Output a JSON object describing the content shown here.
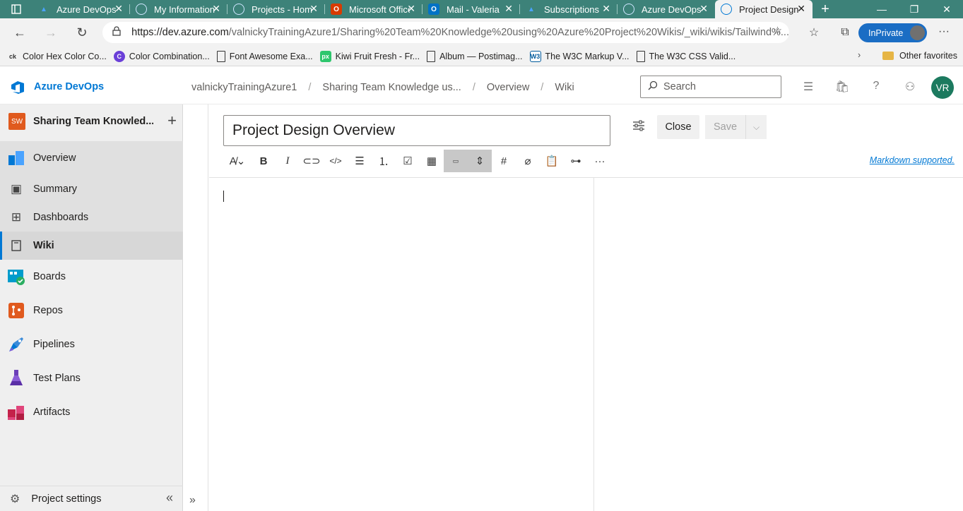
{
  "browser": {
    "tabs": [
      {
        "title": "Azure DevOps",
        "icon": "azure-devops-icon",
        "color": "#0078d4"
      },
      {
        "title": "My Information",
        "icon": "azure-devops-icon",
        "color": "#0078d4"
      },
      {
        "title": "Projects - Home",
        "icon": "azure-devops-icon",
        "color": "#0078d4"
      },
      {
        "title": "Microsoft Office",
        "icon": "office-icon",
        "color": "#d83b01"
      },
      {
        "title": "Mail - Valeria",
        "icon": "outlook-icon",
        "color": "#0072c6"
      },
      {
        "title": "Subscriptions",
        "icon": "azure-icon",
        "color": "#0078d4"
      },
      {
        "title": "Azure DevOps",
        "icon": "azure-devops-icon",
        "color": "#0078d4"
      },
      {
        "title": "Project Design",
        "icon": "azure-devops-icon",
        "color": "#0078d4",
        "active": true
      }
    ],
    "url_host": "https://dev.azure.com",
    "url_path": "/valnickyTrainingAzure1/Sharing%20Team%20Knowledge%20using%20Azure%20Project%20Wikis/_wiki/wikis/Tailwind%...",
    "inprivate_label": "InPrivate",
    "favorites": [
      {
        "label": "Color Hex Color Co...",
        "icon": "colorhex-icon"
      },
      {
        "label": "Color Combination...",
        "icon": "color-combination-icon"
      },
      {
        "label": "Font Awesome Exa...",
        "icon": "page-icon"
      },
      {
        "label": "Kiwi Fruit Fresh - Fr...",
        "icon": "pixabay-icon"
      },
      {
        "label": "Album — Postimag...",
        "icon": "page-icon"
      },
      {
        "label": "The W3C Markup V...",
        "icon": "w3c-icon"
      },
      {
        "label": "The W3C CSS Valid...",
        "icon": "page-icon"
      }
    ],
    "other_favorites": "Other favorites"
  },
  "header": {
    "brand": "Azure DevOps",
    "breadcrumb": [
      "valnickyTrainingAzure1",
      "Sharing Team Knowledge us...",
      "Overview",
      "Wiki"
    ],
    "search_placeholder": "Search",
    "avatar_initials": "VR"
  },
  "sidebar": {
    "project_badge": "SW",
    "project_name": "Sharing Team Knowled...",
    "items": [
      {
        "label": "Overview",
        "icon": "overview-icon"
      },
      {
        "label": "Summary",
        "icon": "summary-icon"
      },
      {
        "label": "Dashboards",
        "icon": "dashboards-icon"
      },
      {
        "label": "Wiki",
        "icon": "wiki-icon"
      },
      {
        "label": "Boards",
        "icon": "boards-icon"
      },
      {
        "label": "Repos",
        "icon": "repos-icon"
      },
      {
        "label": "Pipelines",
        "icon": "pipelines-icon"
      },
      {
        "label": "Test Plans",
        "icon": "test-plans-icon"
      },
      {
        "label": "Artifacts",
        "icon": "artifacts-icon"
      }
    ],
    "settings_label": "Project settings"
  },
  "editor": {
    "page_title": "Project Design Overview",
    "close_label": "Close",
    "save_label": "Save",
    "markdown_link": "Markdown supported."
  }
}
